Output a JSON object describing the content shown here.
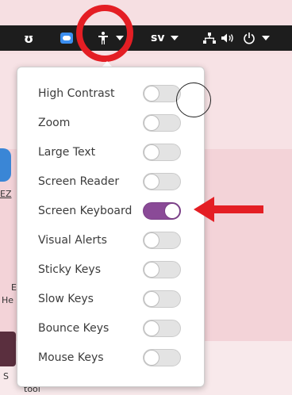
{
  "colors": {
    "accent_purple": "#8a4a97",
    "highlight_red": "#e41e24",
    "panel_bg": "#1d1d1d"
  },
  "topbar": {
    "ubuntu_glyph": "ʊ",
    "language_label": "sv",
    "icons": [
      "ubuntu-icon",
      "teamviewer-icon",
      "accessibility-icon",
      "network-icon",
      "volume-icon",
      "power-icon"
    ]
  },
  "desktop": {
    "fragments": [
      "EZ",
      "E",
      "He",
      "S",
      "tool"
    ]
  },
  "menu": {
    "items": [
      {
        "label": "High Contrast",
        "on": false
      },
      {
        "label": "Zoom",
        "on": false
      },
      {
        "label": "Large Text",
        "on": false
      },
      {
        "label": "Screen Reader",
        "on": false
      },
      {
        "label": "Screen Keyboard",
        "on": true
      },
      {
        "label": "Visual Alerts",
        "on": false
      },
      {
        "label": "Sticky Keys",
        "on": false
      },
      {
        "label": "Slow Keys",
        "on": false
      },
      {
        "label": "Bounce Keys",
        "on": false
      },
      {
        "label": "Mouse Keys",
        "on": false
      }
    ]
  }
}
